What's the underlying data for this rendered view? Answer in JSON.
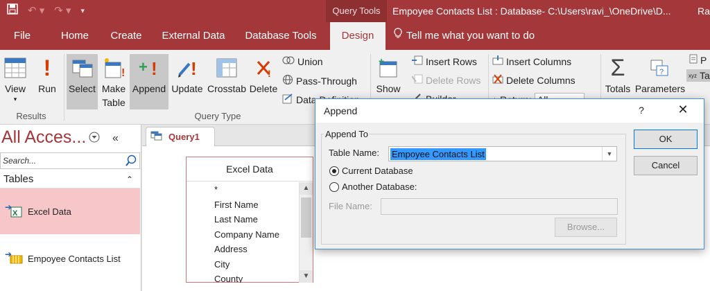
{
  "titlebar": {
    "context_tab": "Query Tools",
    "window_title": "Empoyee Contacts List : Database- C:\\Users\\ravi_\\OneDrive\\D...",
    "user": "Ra"
  },
  "tabs": [
    {
      "label": "File"
    },
    {
      "label": "Home"
    },
    {
      "label": "Create"
    },
    {
      "label": "External Data"
    },
    {
      "label": "Database Tools"
    },
    {
      "label": "Design",
      "active": true
    }
  ],
  "tell_me": "Tell me what you want to do",
  "ribbon": {
    "results": {
      "view": "View",
      "run": "Run",
      "group": "Results"
    },
    "query_type": {
      "select": "Select",
      "make_table_1": "Make",
      "make_table_2": "Table",
      "append": "Append",
      "update": "Update",
      "crosstab": "Crosstab",
      "delete": "Delete",
      "union": "Union",
      "pass_through": "Pass-Through",
      "data_definition": "Data Definition",
      "group": "Query Type"
    },
    "setup": {
      "show": "Show",
      "insert_rows": "Insert Rows",
      "delete_rows": "Delete Rows",
      "builder": "Builder",
      "insert_columns": "Insert Columns",
      "delete_columns": "Delete Columns",
      "return_label": "Return:",
      "return_value": "All"
    },
    "show_hide": {
      "totals": "Totals",
      "parameters": "Parameters",
      "property_sheet": "P",
      "table_names": "Ta"
    }
  },
  "navpane": {
    "title": "All Acces...",
    "search_placeholder": "Search...",
    "category": "Tables",
    "items": [
      {
        "label": "Excel Data",
        "selected": true
      },
      {
        "label": "Empoyee Contacts List",
        "selected": false
      }
    ]
  },
  "document": {
    "tab_label": "Query1",
    "table_box": {
      "title": "Excel Data",
      "fields": [
        "*",
        "First Name",
        "Last Name",
        "Company Name",
        "Address",
        "City",
        "County"
      ]
    }
  },
  "dialog": {
    "title": "Append",
    "help": "?",
    "group_label": "Append To",
    "table_name_label": "Table Name:",
    "table_name_value": "Empoyee Contacts List",
    "current_db": "Current Database",
    "another_db": "Another Database:",
    "file_name_label": "File Name:",
    "browse": "Browse...",
    "ok": "OK",
    "cancel": "Cancel"
  },
  "colors": {
    "accent": "#a4373a",
    "selection": "#3399ff",
    "nav_selected": "#f6c6c8"
  }
}
